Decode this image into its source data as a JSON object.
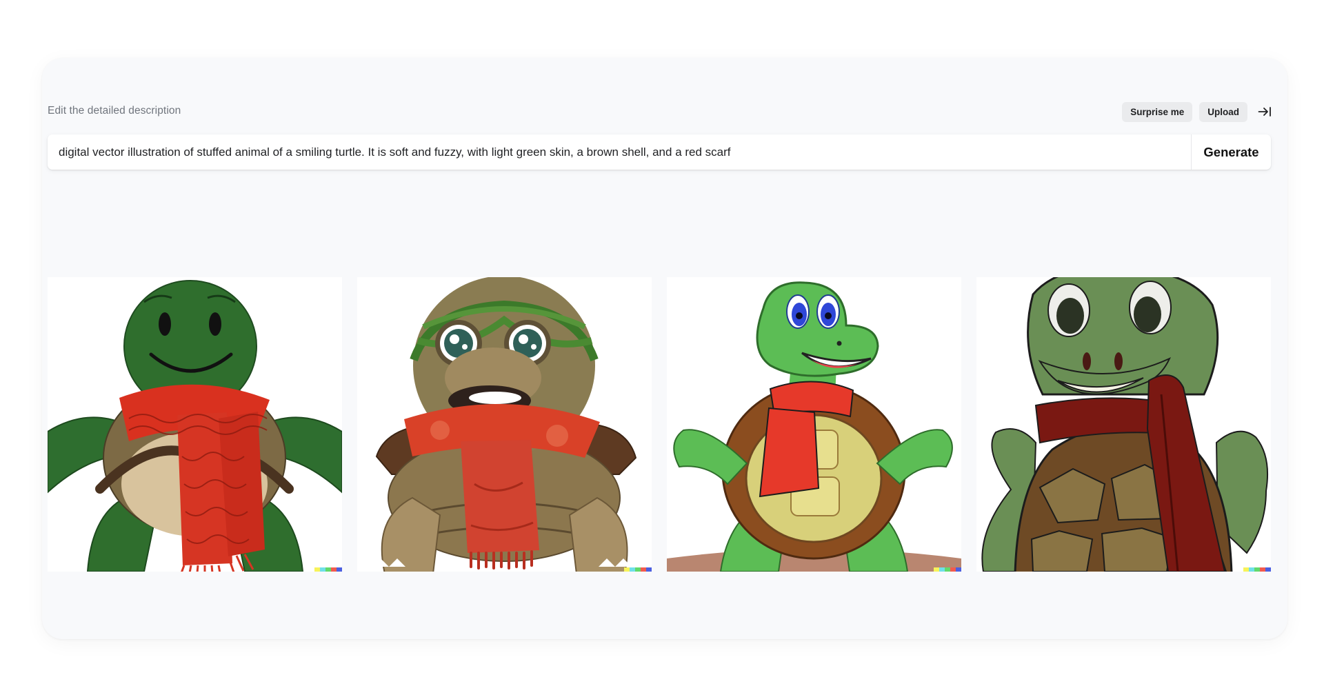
{
  "editor": {
    "label": "Edit the detailed description",
    "surprise_label": "Surprise me",
    "upload_label": "Upload",
    "collapse_icon": "arrow-right-to-line-icon"
  },
  "prompt": {
    "value": "digital vector illustration of stuffed animal of a smiling turtle. It is soft and fuzzy, with light green skin, a brown shell, and a red scarf",
    "generate_label": "Generate"
  },
  "results": {
    "count": 4,
    "signature_colors": [
      "#f7f35a",
      "#6fe0e8",
      "#63d96b",
      "#f25b4e",
      "#4c5fe0"
    ]
  },
  "colors": {
    "panel_bg": "#f8f9fb",
    "pill_bg": "#eaebed",
    "text": "#202123",
    "muted": "#70757d"
  }
}
